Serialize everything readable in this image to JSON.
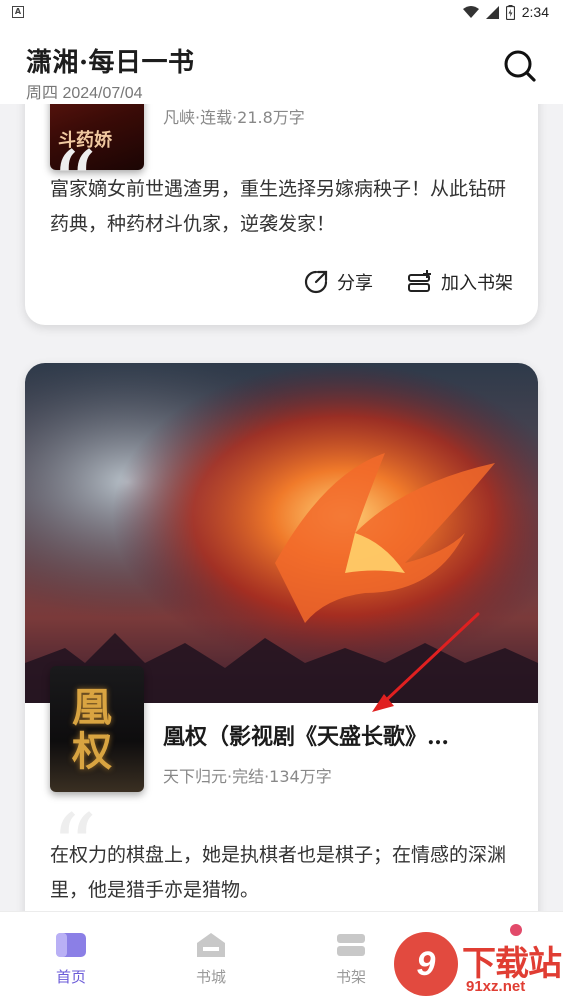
{
  "status_bar": {
    "time": "2:34"
  },
  "header": {
    "title": "潇湘·每日一书",
    "date": "周四 2024/07/04"
  },
  "cards": [
    {
      "cover_text": "斗药娇",
      "meta": "凡峡·连载·21.8万字",
      "description": "富家嫡女前世遇渣男，重生选择另嫁病秧子！从此钻研药典，种药材斗仇家，逆袭发家！",
      "actions": {
        "share": "分享",
        "add_shelf": "加入书架"
      }
    },
    {
      "cover_text": "凰权",
      "title": "凰权（影视剧《天盛长歌》…",
      "meta": "天下归元·完结·134万字",
      "description": "在权力的棋盘上，她是执棋者也是棋子；在情感的深渊里，他是猎手亦是猎物。"
    }
  ],
  "tabbar": {
    "tabs": [
      {
        "label": "首页"
      },
      {
        "label": "书城"
      },
      {
        "label": "书架"
      }
    ]
  },
  "watermark": {
    "badge": "9",
    "text": "下载站",
    "url": "91xz.net"
  },
  "colors": {
    "accent": "#6b5bd8",
    "watermark": "#e03d33",
    "arrow": "#e02020"
  }
}
